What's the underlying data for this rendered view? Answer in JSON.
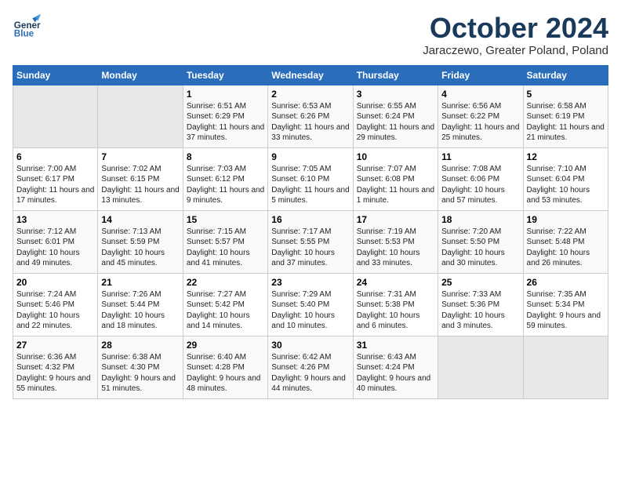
{
  "header": {
    "logo_line1": "General",
    "logo_line2": "Blue",
    "month": "October 2024",
    "location": "Jaraczewo, Greater Poland, Poland"
  },
  "weekdays": [
    "Sunday",
    "Monday",
    "Tuesday",
    "Wednesday",
    "Thursday",
    "Friday",
    "Saturday"
  ],
  "weeks": [
    [
      {
        "day": "",
        "empty": true
      },
      {
        "day": "",
        "empty": true
      },
      {
        "day": "1",
        "sunrise": "6:51 AM",
        "sunset": "6:29 PM",
        "daylight": "11 hours and 37 minutes."
      },
      {
        "day": "2",
        "sunrise": "6:53 AM",
        "sunset": "6:26 PM",
        "daylight": "11 hours and 33 minutes."
      },
      {
        "day": "3",
        "sunrise": "6:55 AM",
        "sunset": "6:24 PM",
        "daylight": "11 hours and 29 minutes."
      },
      {
        "day": "4",
        "sunrise": "6:56 AM",
        "sunset": "6:22 PM",
        "daylight": "11 hours and 25 minutes."
      },
      {
        "day": "5",
        "sunrise": "6:58 AM",
        "sunset": "6:19 PM",
        "daylight": "11 hours and 21 minutes."
      }
    ],
    [
      {
        "day": "6",
        "sunrise": "7:00 AM",
        "sunset": "6:17 PM",
        "daylight": "11 hours and 17 minutes."
      },
      {
        "day": "7",
        "sunrise": "7:02 AM",
        "sunset": "6:15 PM",
        "daylight": "11 hours and 13 minutes."
      },
      {
        "day": "8",
        "sunrise": "7:03 AM",
        "sunset": "6:12 PM",
        "daylight": "11 hours and 9 minutes."
      },
      {
        "day": "9",
        "sunrise": "7:05 AM",
        "sunset": "6:10 PM",
        "daylight": "11 hours and 5 minutes."
      },
      {
        "day": "10",
        "sunrise": "7:07 AM",
        "sunset": "6:08 PM",
        "daylight": "11 hours and 1 minute."
      },
      {
        "day": "11",
        "sunrise": "7:08 AM",
        "sunset": "6:06 PM",
        "daylight": "10 hours and 57 minutes."
      },
      {
        "day": "12",
        "sunrise": "7:10 AM",
        "sunset": "6:04 PM",
        "daylight": "10 hours and 53 minutes."
      }
    ],
    [
      {
        "day": "13",
        "sunrise": "7:12 AM",
        "sunset": "6:01 PM",
        "daylight": "10 hours and 49 minutes."
      },
      {
        "day": "14",
        "sunrise": "7:13 AM",
        "sunset": "5:59 PM",
        "daylight": "10 hours and 45 minutes."
      },
      {
        "day": "15",
        "sunrise": "7:15 AM",
        "sunset": "5:57 PM",
        "daylight": "10 hours and 41 minutes."
      },
      {
        "day": "16",
        "sunrise": "7:17 AM",
        "sunset": "5:55 PM",
        "daylight": "10 hours and 37 minutes."
      },
      {
        "day": "17",
        "sunrise": "7:19 AM",
        "sunset": "5:53 PM",
        "daylight": "10 hours and 33 minutes."
      },
      {
        "day": "18",
        "sunrise": "7:20 AM",
        "sunset": "5:50 PM",
        "daylight": "10 hours and 30 minutes."
      },
      {
        "day": "19",
        "sunrise": "7:22 AM",
        "sunset": "5:48 PM",
        "daylight": "10 hours and 26 minutes."
      }
    ],
    [
      {
        "day": "20",
        "sunrise": "7:24 AM",
        "sunset": "5:46 PM",
        "daylight": "10 hours and 22 minutes."
      },
      {
        "day": "21",
        "sunrise": "7:26 AM",
        "sunset": "5:44 PM",
        "daylight": "10 hours and 18 minutes."
      },
      {
        "day": "22",
        "sunrise": "7:27 AM",
        "sunset": "5:42 PM",
        "daylight": "10 hours and 14 minutes."
      },
      {
        "day": "23",
        "sunrise": "7:29 AM",
        "sunset": "5:40 PM",
        "daylight": "10 hours and 10 minutes."
      },
      {
        "day": "24",
        "sunrise": "7:31 AM",
        "sunset": "5:38 PM",
        "daylight": "10 hours and 6 minutes."
      },
      {
        "day": "25",
        "sunrise": "7:33 AM",
        "sunset": "5:36 PM",
        "daylight": "10 hours and 3 minutes."
      },
      {
        "day": "26",
        "sunrise": "7:35 AM",
        "sunset": "5:34 PM",
        "daylight": "9 hours and 59 minutes."
      }
    ],
    [
      {
        "day": "27",
        "sunrise": "6:36 AM",
        "sunset": "4:32 PM",
        "daylight": "9 hours and 55 minutes."
      },
      {
        "day": "28",
        "sunrise": "6:38 AM",
        "sunset": "4:30 PM",
        "daylight": "9 hours and 51 minutes."
      },
      {
        "day": "29",
        "sunrise": "6:40 AM",
        "sunset": "4:28 PM",
        "daylight": "9 hours and 48 minutes."
      },
      {
        "day": "30",
        "sunrise": "6:42 AM",
        "sunset": "4:26 PM",
        "daylight": "9 hours and 44 minutes."
      },
      {
        "day": "31",
        "sunrise": "6:43 AM",
        "sunset": "4:24 PM",
        "daylight": "9 hours and 40 minutes."
      },
      {
        "day": "",
        "empty": true
      },
      {
        "day": "",
        "empty": true
      }
    ]
  ]
}
